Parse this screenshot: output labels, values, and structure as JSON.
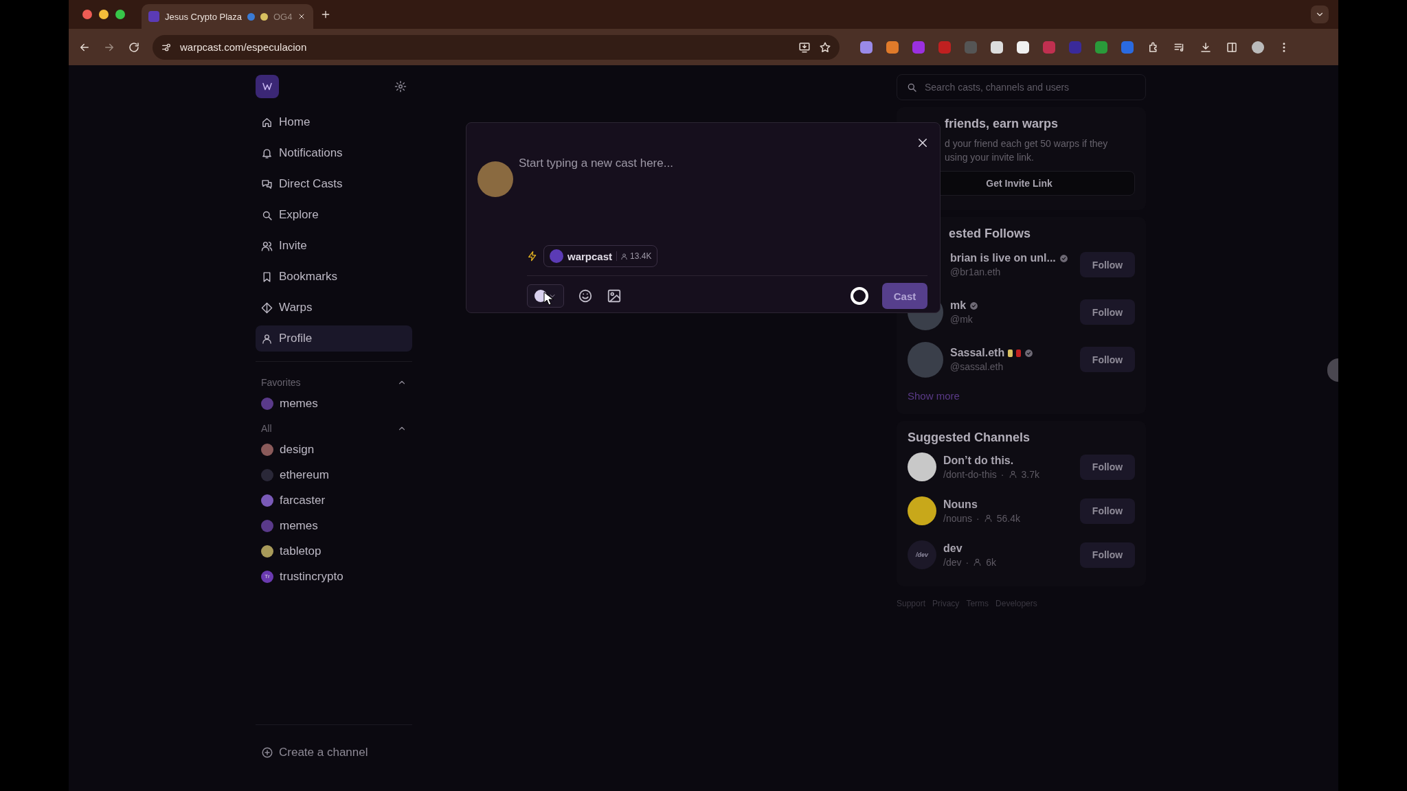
{
  "browser": {
    "tab": {
      "title": "Jesus Crypto Plaza",
      "title_tail": "OG4",
      "selected": true
    },
    "address": "warpcast.com/especulacion"
  },
  "sidebar": {
    "nav": [
      {
        "label": "Home",
        "selected": false
      },
      {
        "label": "Notifications",
        "selected": false
      },
      {
        "label": "Direct Casts",
        "selected": false
      },
      {
        "label": "Explore",
        "selected": false
      },
      {
        "label": "Invite",
        "selected": false
      },
      {
        "label": "Bookmarks",
        "selected": false
      },
      {
        "label": "Warps",
        "selected": false
      },
      {
        "label": "Profile",
        "selected": true
      }
    ],
    "groups": [
      {
        "title": "Favorites",
        "expanded": true,
        "channels": [
          {
            "name": "memes",
            "color": "#5a3a8a"
          }
        ]
      },
      {
        "title": "All",
        "expanded": true,
        "channels": [
          {
            "name": "design",
            "color": "#8a5a5a"
          },
          {
            "name": "ethereum",
            "color": "#2a2838"
          },
          {
            "name": "farcaster",
            "color": "#7a5ab8"
          },
          {
            "name": "memes",
            "color": "#5a3a8a"
          },
          {
            "name": "tabletop",
            "color": "#a89a5a"
          },
          {
            "name": "trustincrypto",
            "color": "#6a3ab0",
            "initials": "Tr"
          }
        ]
      }
    ],
    "create_channel": "Create a channel"
  },
  "composer": {
    "placeholder": "Start typing a new cast here...",
    "channel": {
      "name": "warpcast",
      "members": "13.4K"
    },
    "cast_button": "Cast"
  },
  "right": {
    "search": {
      "placeholder": "Search casts, channels and users"
    },
    "invite": {
      "title": "friends, earn warps",
      "body": [
        "d your friend each get 50 warps if they",
        "using your invite link."
      ],
      "button": "Get Invite Link"
    },
    "follows": {
      "title": "ested Follows",
      "users": [
        {
          "name": "brian is live on unl...",
          "handle": "@br1an.eth",
          "verified": true,
          "avatar": false,
          "emoji": false,
          "follow": "Follow"
        },
        {
          "name": "mk",
          "handle": "@mk",
          "verified": true,
          "avatar": true,
          "emoji": false,
          "follow": "Follow"
        },
        {
          "name": "Sassal.eth",
          "handle": "@sassal.eth",
          "verified": true,
          "avatar": true,
          "emoji": true,
          "follow": "Follow"
        }
      ],
      "show_more": "Show more"
    },
    "channels": {
      "title": "Suggested Channels",
      "items": [
        {
          "name": "Don’t do this.",
          "path": "/dont-do-this",
          "separator": "·",
          "members": "3.7k",
          "color": "#c8c8c8",
          "follow": "Follow"
        },
        {
          "name": "Nouns",
          "path": "/nouns",
          "separator": "·",
          "members": "56.4k",
          "color": "#c8a81a",
          "follow": "Follow"
        },
        {
          "name": "dev",
          "path": "/dev",
          "separator": "·",
          "members": "6k",
          "color": "#1c1828",
          "avatar_text": "/dev",
          "follow": "Follow"
        }
      ]
    },
    "footer": [
      "Support",
      "Privacy",
      "Terms",
      "Developers"
    ]
  }
}
